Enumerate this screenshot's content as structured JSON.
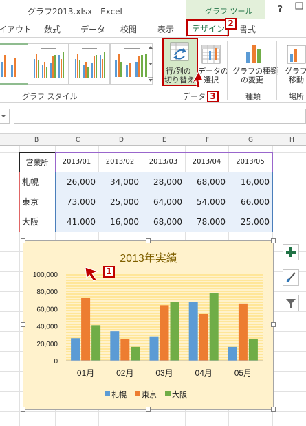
{
  "window": {
    "title": "グラフ2013.xlsx - Excel",
    "context_tab_title": "グラフ ツール",
    "help": "?"
  },
  "tabs": [
    "イアウト",
    "数式",
    "データ",
    "校閲",
    "表示",
    "デザイン",
    "書式"
  ],
  "ribbon": {
    "groups": {
      "chart_styles": "グラフ スタイル",
      "data": "データ",
      "type": "種類",
      "location": "場所"
    },
    "buttons": {
      "switch_row_col": [
        "行/列の",
        "切り替え"
      ],
      "select_data": [
        "データの",
        "選択"
      ],
      "change_type": [
        "グラフの種類",
        "の変更"
      ],
      "move_chart": [
        "グラフの",
        "移動"
      ]
    }
  },
  "annotations": {
    "badge1": "1",
    "badge2": "2",
    "badge3": "3"
  },
  "sheet": {
    "columns": [
      "B",
      "C",
      "D",
      "E",
      "F",
      "G",
      "H"
    ],
    "table": {
      "corner": "営業所",
      "headers": [
        "2013/01",
        "2013/02",
        "2013/03",
        "2013/04",
        "2013/05"
      ],
      "rows": [
        {
          "city": "札幌",
          "values": [
            "26,000",
            "34,000",
            "28,000",
            "68,000",
            "16,000"
          ]
        },
        {
          "city": "東京",
          "values": [
            "73,000",
            "25,000",
            "64,000",
            "54,000",
            "66,000"
          ]
        },
        {
          "city": "大阪",
          "values": [
            "41,000",
            "16,000",
            "68,000",
            "78,000",
            "25,000"
          ]
        }
      ]
    }
  },
  "chart_data": {
    "type": "bar",
    "title": "2013年実績",
    "categories": [
      "01月",
      "02月",
      "03月",
      "04月",
      "05月"
    ],
    "series": [
      {
        "name": "札幌",
        "values": [
          26000,
          34000,
          28000,
          68000,
          16000
        ],
        "color": "#5b9bd5"
      },
      {
        "name": "東京",
        "values": [
          73000,
          25000,
          64000,
          54000,
          66000
        ],
        "color": "#ed7d31"
      },
      {
        "name": "大阪",
        "values": [
          41000,
          16000,
          68000,
          78000,
          25000
        ],
        "color": "#70ad47"
      }
    ],
    "ylim": [
      0,
      100000
    ],
    "yticks": [
      "0",
      "20,000",
      "40,000",
      "60,000",
      "80,000",
      "100,000"
    ],
    "legend_position": "bottom",
    "plot_background": "striped yellow"
  },
  "side_buttons": [
    "plus-icon",
    "brush-icon",
    "filter-icon"
  ]
}
